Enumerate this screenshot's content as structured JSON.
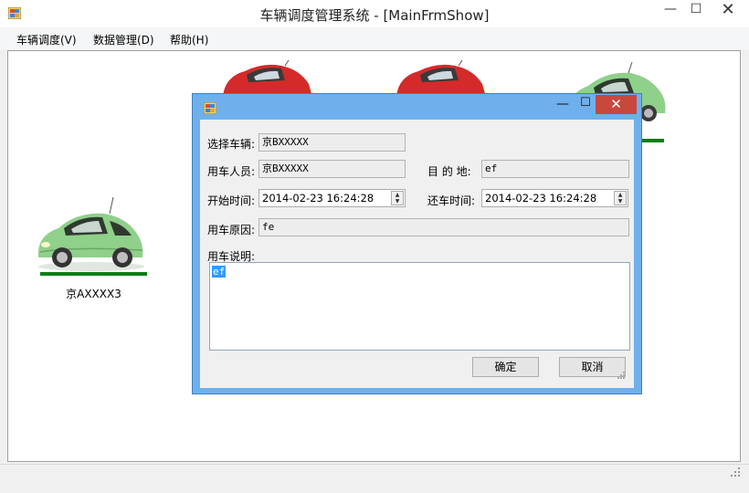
{
  "window": {
    "title": "车辆调度管理系统 - [MainFrmShow]",
    "min_glyph": "—",
    "max_glyph": "☐",
    "close_glyph": "✕"
  },
  "menu": {
    "items": [
      {
        "label": "车辆调度(V)"
      },
      {
        "label": "数据管理(D)"
      },
      {
        "label": "帮助(H)"
      }
    ]
  },
  "cars": [
    {
      "label": "",
      "color": "red",
      "bar": false
    },
    {
      "label": "",
      "color": "red",
      "bar": false
    },
    {
      "label": "",
      "color": "green",
      "bar": true
    },
    {
      "label": "京AXXXX3",
      "color": "green",
      "bar": true
    }
  ],
  "dialog": {
    "min_glyph": "—",
    "max_glyph": "☐",
    "close_glyph": "✕",
    "vehicle_label": "选择车辆:",
    "vehicle_value": "京BXXXXX",
    "user_label": "用车人员:",
    "user_value": "京BXXXXX",
    "destination_label": "目 的 地:",
    "destination_value": "ef",
    "start_label": "开始时间:",
    "start_value": "2014-02-23 16:24:28",
    "return_label": "还车时间:",
    "return_value": "2014-02-23 16:24:28",
    "reason_label": "用车原因:",
    "reason_value": "fe",
    "notes_label": "用车说明:",
    "notes_value": "ef",
    "ok_label": "确定",
    "cancel_label": "取消"
  },
  "colors": {
    "dialog_frame": "#6fb0ec",
    "close_button": "#c9483e",
    "car_bar": "#0e7d16",
    "selection": "#3399ff"
  }
}
